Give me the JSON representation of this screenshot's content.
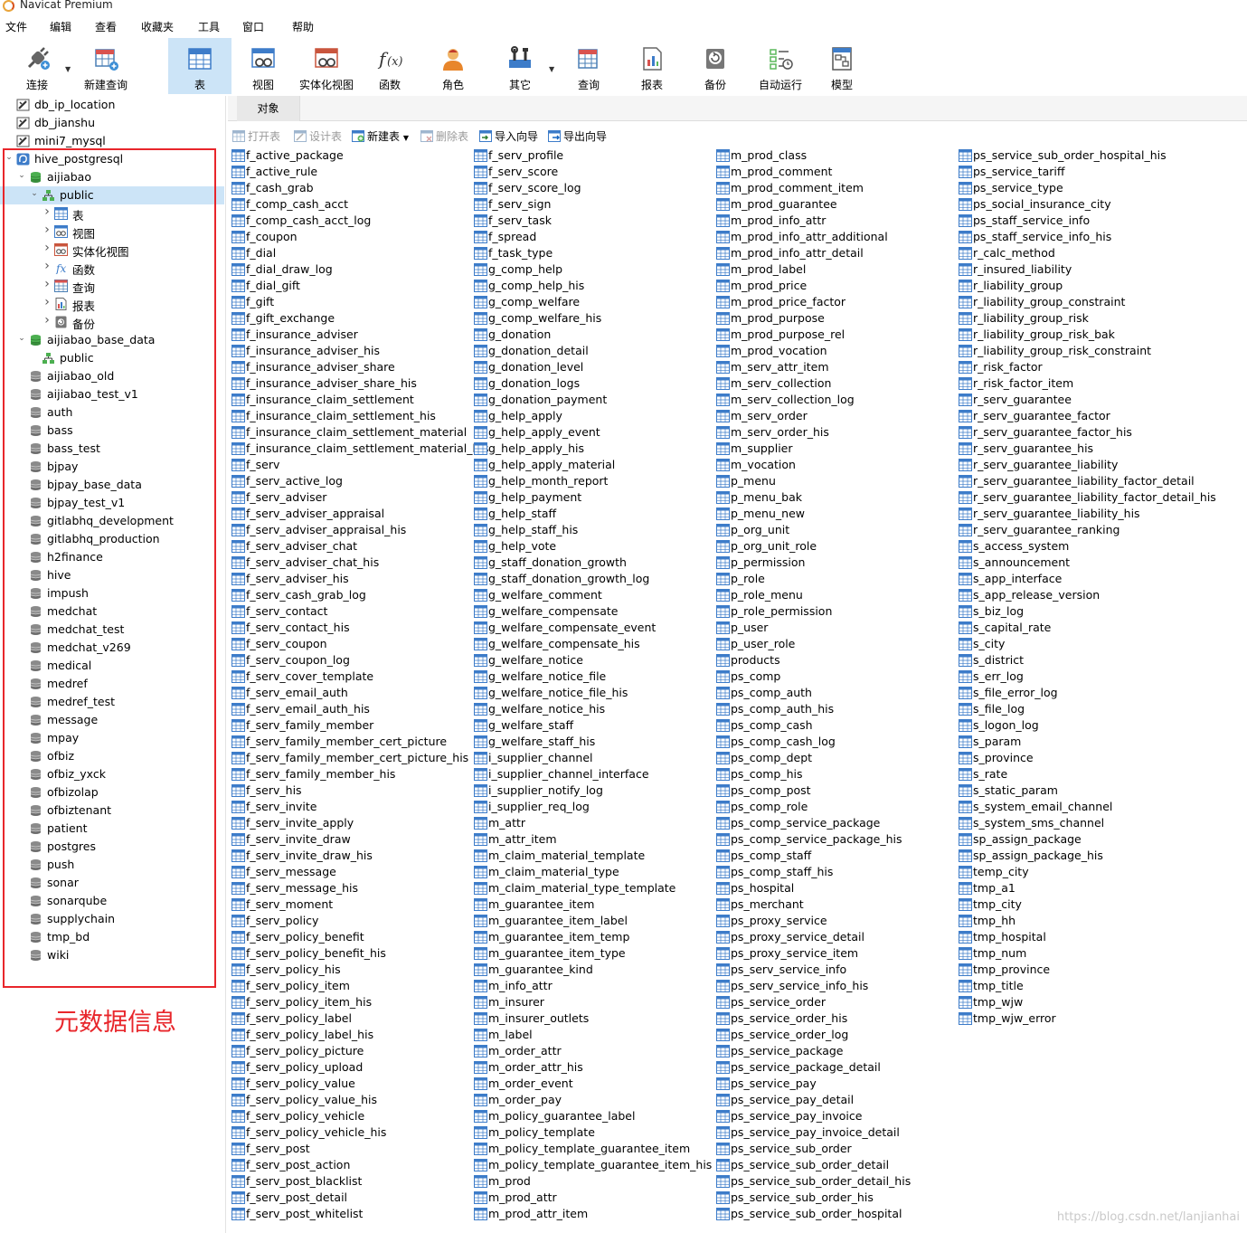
{
  "window": {
    "title": "Navicat Premium"
  },
  "menu": [
    "文件",
    "编辑",
    "查看",
    "收藏夹",
    "工具",
    "窗口",
    "帮助"
  ],
  "toolbar": {
    "buttons": [
      {
        "label": "连接",
        "icon": "connect-plug-icon"
      },
      {
        "label": "新建查询",
        "icon": "new-query-icon"
      },
      {
        "label": "表",
        "icon": "table-icon",
        "active": true
      },
      {
        "label": "视图",
        "icon": "view-icon"
      },
      {
        "label": "实体化视图",
        "icon": "materialized-view-icon"
      },
      {
        "label": "函数",
        "icon": "function-icon"
      },
      {
        "label": "角色",
        "icon": "role-user-icon"
      },
      {
        "label": "其它",
        "icon": "tools-icon"
      },
      {
        "label": "查询",
        "icon": "query-icon"
      },
      {
        "label": "报表",
        "icon": "report-icon"
      },
      {
        "label": "备份",
        "icon": "backup-icon"
      },
      {
        "label": "自动运行",
        "icon": "automation-icon"
      },
      {
        "label": "模型",
        "icon": "model-icon"
      }
    ]
  },
  "sidebar": {
    "items": [
      {
        "label": "db_ip_location",
        "icon": "connection-icon"
      },
      {
        "label": "db_jianshu",
        "icon": "connection-icon"
      },
      {
        "label": "mini7_mysql",
        "icon": "connection-icon"
      },
      {
        "label": "hive_postgresql",
        "icon": "postgresql-connection-icon"
      },
      {
        "label": "aijiabao",
        "icon": "database-open-icon"
      },
      {
        "label": "public",
        "icon": "schema-icon"
      },
      {
        "label": "表",
        "icon": "table-icon"
      },
      {
        "label": "视图",
        "icon": "view-icon"
      },
      {
        "label": "实体化视图",
        "icon": "materialized-view-icon"
      },
      {
        "label": "函数",
        "icon": "function-icon"
      },
      {
        "label": "查询",
        "icon": "query-icon"
      },
      {
        "label": "报表",
        "icon": "report-icon"
      },
      {
        "label": "备份",
        "icon": "backup-icon"
      },
      {
        "label": "aijiabao_base_data",
        "icon": "database-open-icon"
      },
      {
        "label": "public",
        "icon": "schema-icon"
      },
      {
        "label": "aijiabao_old",
        "icon": "database-icon"
      },
      {
        "label": "aijiabao_test_v1",
        "icon": "database-icon"
      },
      {
        "label": "auth",
        "icon": "database-icon"
      },
      {
        "label": "bass",
        "icon": "database-icon"
      },
      {
        "label": "bass_test",
        "icon": "database-icon"
      },
      {
        "label": "bjpay",
        "icon": "database-icon"
      },
      {
        "label": "bjpay_base_data",
        "icon": "database-icon"
      },
      {
        "label": "bjpay_test_v1",
        "icon": "database-icon"
      },
      {
        "label": "gitlabhq_development",
        "icon": "database-icon"
      },
      {
        "label": "gitlabhq_production",
        "icon": "database-icon"
      },
      {
        "label": "h2finance",
        "icon": "database-icon"
      },
      {
        "label": "hive",
        "icon": "database-icon"
      },
      {
        "label": "impush",
        "icon": "database-icon"
      },
      {
        "label": "medchat",
        "icon": "database-icon"
      },
      {
        "label": "medchat_test",
        "icon": "database-icon"
      },
      {
        "label": "medchat_v269",
        "icon": "database-icon"
      },
      {
        "label": "medical",
        "icon": "database-icon"
      },
      {
        "label": "medref",
        "icon": "database-icon"
      },
      {
        "label": "medref_test",
        "icon": "database-icon"
      },
      {
        "label": "message",
        "icon": "database-icon"
      },
      {
        "label": "mpay",
        "icon": "database-icon"
      },
      {
        "label": "ofbiz",
        "icon": "database-icon"
      },
      {
        "label": "ofbiz_yxck",
        "icon": "database-icon"
      },
      {
        "label": "ofbizolap",
        "icon": "database-icon"
      },
      {
        "label": "ofbiztenant",
        "icon": "database-icon"
      },
      {
        "label": "patient",
        "icon": "database-icon"
      },
      {
        "label": "postgres",
        "icon": "database-icon"
      },
      {
        "label": "push",
        "icon": "database-icon"
      },
      {
        "label": "sonar",
        "icon": "database-icon"
      },
      {
        "label": "sonarqube",
        "icon": "database-icon"
      },
      {
        "label": "supplychain",
        "icon": "database-icon"
      },
      {
        "label": "tmp_bd",
        "icon": "database-icon"
      },
      {
        "label": "wiki",
        "icon": "database-icon"
      }
    ]
  },
  "annotation": {
    "text": "元数据信息",
    "color": "#e8262b"
  },
  "object_tab": {
    "label": "对象"
  },
  "object_toolbar": [
    {
      "label": "打开表",
      "icon": "open-table-icon",
      "disabled": true
    },
    {
      "label": "设计表",
      "icon": "design-table-icon",
      "disabled": true
    },
    {
      "label": "新建表",
      "icon": "new-table-icon",
      "disabled": false
    },
    {
      "label": "删除表",
      "icon": "delete-table-icon",
      "disabled": true
    },
    {
      "label": "导入向导",
      "icon": "import-wizard-icon",
      "disabled": false
    },
    {
      "label": "导出向导",
      "icon": "export-wizard-icon",
      "disabled": false
    }
  ],
  "tables": {
    "columns": [
      [
        "f_active_package",
        "f_active_rule",
        "f_cash_grab",
        "f_comp_cash_acct",
        "f_comp_cash_acct_log",
        "f_coupon",
        "f_dial",
        "f_dial_draw_log",
        "f_dial_gift",
        "f_gift",
        "f_gift_exchange",
        "f_insurance_adviser",
        "f_insurance_adviser_his",
        "f_insurance_adviser_share",
        "f_insurance_adviser_share_his",
        "f_insurance_claim_settlement",
        "f_insurance_claim_settlement_his",
        "f_insurance_claim_settlement_material",
        "f_insurance_claim_settlement_material_his",
        "f_serv",
        "f_serv_active_log",
        "f_serv_adviser",
        "f_serv_adviser_appraisal",
        "f_serv_adviser_appraisal_his",
        "f_serv_adviser_chat",
        "f_serv_adviser_chat_his",
        "f_serv_adviser_his",
        "f_serv_cash_grab_log",
        "f_serv_contact",
        "f_serv_contact_his",
        "f_serv_coupon",
        "f_serv_coupon_log",
        "f_serv_cover_template",
        "f_serv_email_auth",
        "f_serv_email_auth_his",
        "f_serv_family_member",
        "f_serv_family_member_cert_picture",
        "f_serv_family_member_cert_picture_his",
        "f_serv_family_member_his",
        "f_serv_his",
        "f_serv_invite",
        "f_serv_invite_apply",
        "f_serv_invite_draw",
        "f_serv_invite_draw_his",
        "f_serv_message",
        "f_serv_message_his",
        "f_serv_moment",
        "f_serv_policy",
        "f_serv_policy_benefit",
        "f_serv_policy_benefit_his",
        "f_serv_policy_his",
        "f_serv_policy_item",
        "f_serv_policy_item_his",
        "f_serv_policy_label",
        "f_serv_policy_label_his",
        "f_serv_policy_picture",
        "f_serv_policy_upload",
        "f_serv_policy_value",
        "f_serv_policy_value_his",
        "f_serv_policy_vehicle",
        "f_serv_policy_vehicle_his",
        "f_serv_post",
        "f_serv_post_action",
        "f_serv_post_blacklist",
        "f_serv_post_detail",
        "f_serv_post_whitelist"
      ],
      [
        "f_serv_profile",
        "f_serv_score",
        "f_serv_score_log",
        "f_serv_sign",
        "f_serv_task",
        "f_spread",
        "f_task_type",
        "g_comp_help",
        "g_comp_help_his",
        "g_comp_welfare",
        "g_comp_welfare_his",
        "g_donation",
        "g_donation_detail",
        "g_donation_level",
        "g_donation_logs",
        "g_donation_payment",
        "g_help_apply",
        "g_help_apply_event",
        "g_help_apply_his",
        "g_help_apply_material",
        "g_help_month_report",
        "g_help_payment",
        "g_help_staff",
        "g_help_staff_his",
        "g_help_vote",
        "g_staff_donation_growth",
        "g_staff_donation_growth_log",
        "g_welfare_comment",
        "g_welfare_compensate",
        "g_welfare_compensate_event",
        "g_welfare_compensate_his",
        "g_welfare_notice",
        "g_welfare_notice_file",
        "g_welfare_notice_file_his",
        "g_welfare_notice_his",
        "g_welfare_staff",
        "g_welfare_staff_his",
        "i_supplier_channel",
        "i_supplier_channel_interface",
        "i_supplier_notify_log",
        "i_supplier_req_log",
        "m_attr",
        "m_attr_item",
        "m_claim_material_template",
        "m_claim_material_type",
        "m_claim_material_type_template",
        "m_guarantee_item",
        "m_guarantee_item_label",
        "m_guarantee_item_temp",
        "m_guarantee_item_type",
        "m_guarantee_kind",
        "m_info_attr",
        "m_insurer",
        "m_insurer_outlets",
        "m_label",
        "m_order_attr",
        "m_order_attr_his",
        "m_order_event",
        "m_order_pay",
        "m_policy_guarantee_label",
        "m_policy_template",
        "m_policy_template_guarantee_item",
        "m_policy_template_guarantee_item_his",
        "m_prod",
        "m_prod_attr",
        "m_prod_attr_item"
      ],
      [
        "m_prod_class",
        "m_prod_comment",
        "m_prod_comment_item",
        "m_prod_guarantee",
        "m_prod_info_attr",
        "m_prod_info_attr_additional",
        "m_prod_info_attr_detail",
        "m_prod_label",
        "m_prod_price",
        "m_prod_price_factor",
        "m_prod_purpose",
        "m_prod_purpose_rel",
        "m_prod_vocation",
        "m_serv_attr_item",
        "m_serv_collection",
        "m_serv_collection_log",
        "m_serv_order",
        "m_serv_order_his",
        "m_supplier",
        "m_vocation",
        "p_menu",
        "p_menu_bak",
        "p_menu_new",
        "p_org_unit",
        "p_org_unit_role",
        "p_permission",
        "p_role",
        "p_role_menu",
        "p_role_permission",
        "p_user",
        "p_user_role",
        "products",
        "ps_comp",
        "ps_comp_auth",
        "ps_comp_auth_his",
        "ps_comp_cash",
        "ps_comp_cash_log",
        "ps_comp_dept",
        "ps_comp_his",
        "ps_comp_post",
        "ps_comp_role",
        "ps_comp_service_package",
        "ps_comp_service_package_his",
        "ps_comp_staff",
        "ps_comp_staff_his",
        "ps_hospital",
        "ps_merchant",
        "ps_proxy_service",
        "ps_proxy_service_detail",
        "ps_proxy_service_item",
        "ps_serv_service_info",
        "ps_serv_service_info_his",
        "ps_service_order",
        "ps_service_order_his",
        "ps_service_order_log",
        "ps_service_package",
        "ps_service_package_detail",
        "ps_service_pay",
        "ps_service_pay_detail",
        "ps_service_pay_invoice",
        "ps_service_pay_invoice_detail",
        "ps_service_sub_order",
        "ps_service_sub_order_detail",
        "ps_service_sub_order_detail_his",
        "ps_service_sub_order_his",
        "ps_service_sub_order_hospital"
      ],
      [
        "ps_service_sub_order_hospital_his",
        "ps_service_tariff",
        "ps_service_type",
        "ps_social_insurance_city",
        "ps_staff_service_info",
        "ps_staff_service_info_his",
        "r_calc_method",
        "r_insured_liability",
        "r_liability_group",
        "r_liability_group_constraint",
        "r_liability_group_risk",
        "r_liability_group_risk_bak",
        "r_liability_group_risk_constraint",
        "r_risk_factor",
        "r_risk_factor_item",
        "r_serv_guarantee",
        "r_serv_guarantee_factor",
        "r_serv_guarantee_factor_his",
        "r_serv_guarantee_his",
        "r_serv_guarantee_liability",
        "r_serv_guarantee_liability_factor_detail",
        "r_serv_guarantee_liability_factor_detail_his",
        "r_serv_guarantee_liability_his",
        "r_serv_guarantee_ranking",
        "s_access_system",
        "s_announcement",
        "s_app_interface",
        "s_app_release_version",
        "s_biz_log",
        "s_capital_rate",
        "s_city",
        "s_district",
        "s_err_log",
        "s_file_error_log",
        "s_file_log",
        "s_logon_log",
        "s_param",
        "s_province",
        "s_rate",
        "s_static_param",
        "s_system_email_channel",
        "s_system_sms_channel",
        "sp_assign_package",
        "sp_assign_package_his",
        "temp_city",
        "tmp_a1",
        "tmp_city",
        "tmp_hh",
        "tmp_hospital",
        "tmp_num",
        "tmp_province",
        "tmp_title",
        "tmp_wjw",
        "tmp_wjw_error"
      ]
    ]
  },
  "watermark": "https://blog.csdn.net/lanjianhai"
}
